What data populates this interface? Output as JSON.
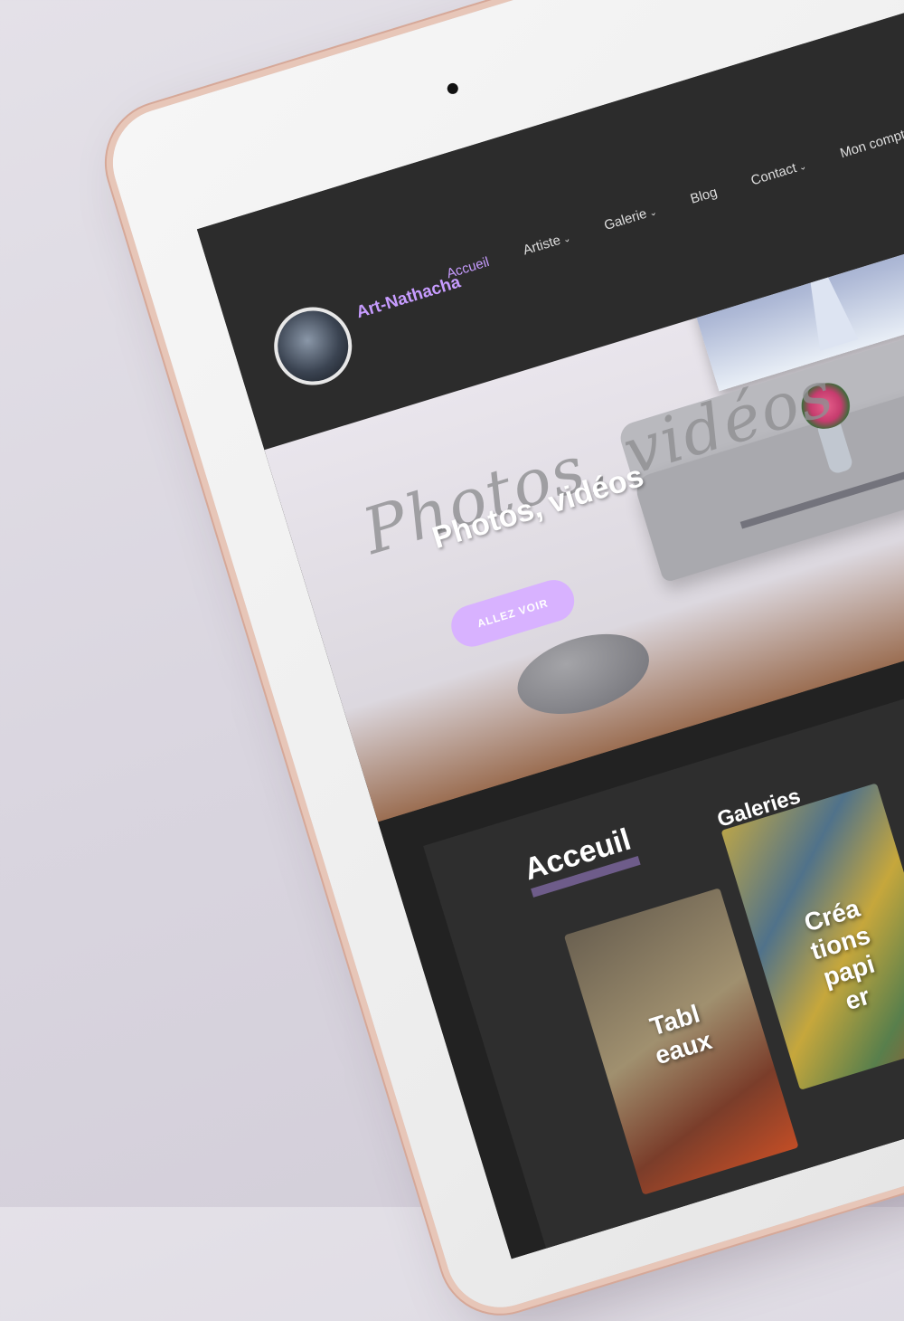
{
  "site": {
    "brand": "Art-Nathacha"
  },
  "nav": {
    "items": [
      {
        "label": "Accueil",
        "has_chevron": false,
        "active": true
      },
      {
        "label": "Artiste",
        "has_chevron": true,
        "active": false
      },
      {
        "label": "Galerie",
        "has_chevron": true,
        "active": false
      },
      {
        "label": "Blog",
        "has_chevron": false,
        "active": false
      },
      {
        "label": "Contact",
        "has_chevron": true,
        "active": false
      },
      {
        "label": "Mon compte",
        "has_chevron": true,
        "active": false
      }
    ],
    "chevron_glyph": "⌄",
    "menu_icon": "hamburger-menu-icon"
  },
  "hero": {
    "script_text": "Photos, vidéos",
    "title": "Photos, vidéos",
    "button_label": "ALLEZ VOIR"
  },
  "main": {
    "section_title": "Acceuil",
    "galleries_title": "Galeries",
    "cards": [
      {
        "label_line1": "Tabl",
        "label_line2": "eaux"
      },
      {
        "label_line1": "Créa",
        "label_line2": "tions",
        "label_line3": "papi",
        "label_line4": "er"
      }
    ]
  },
  "colors": {
    "accent": "#c79cff",
    "button": "#d8b2ff",
    "header_bg": "#2c2c2c",
    "page_bg": "#222222"
  }
}
